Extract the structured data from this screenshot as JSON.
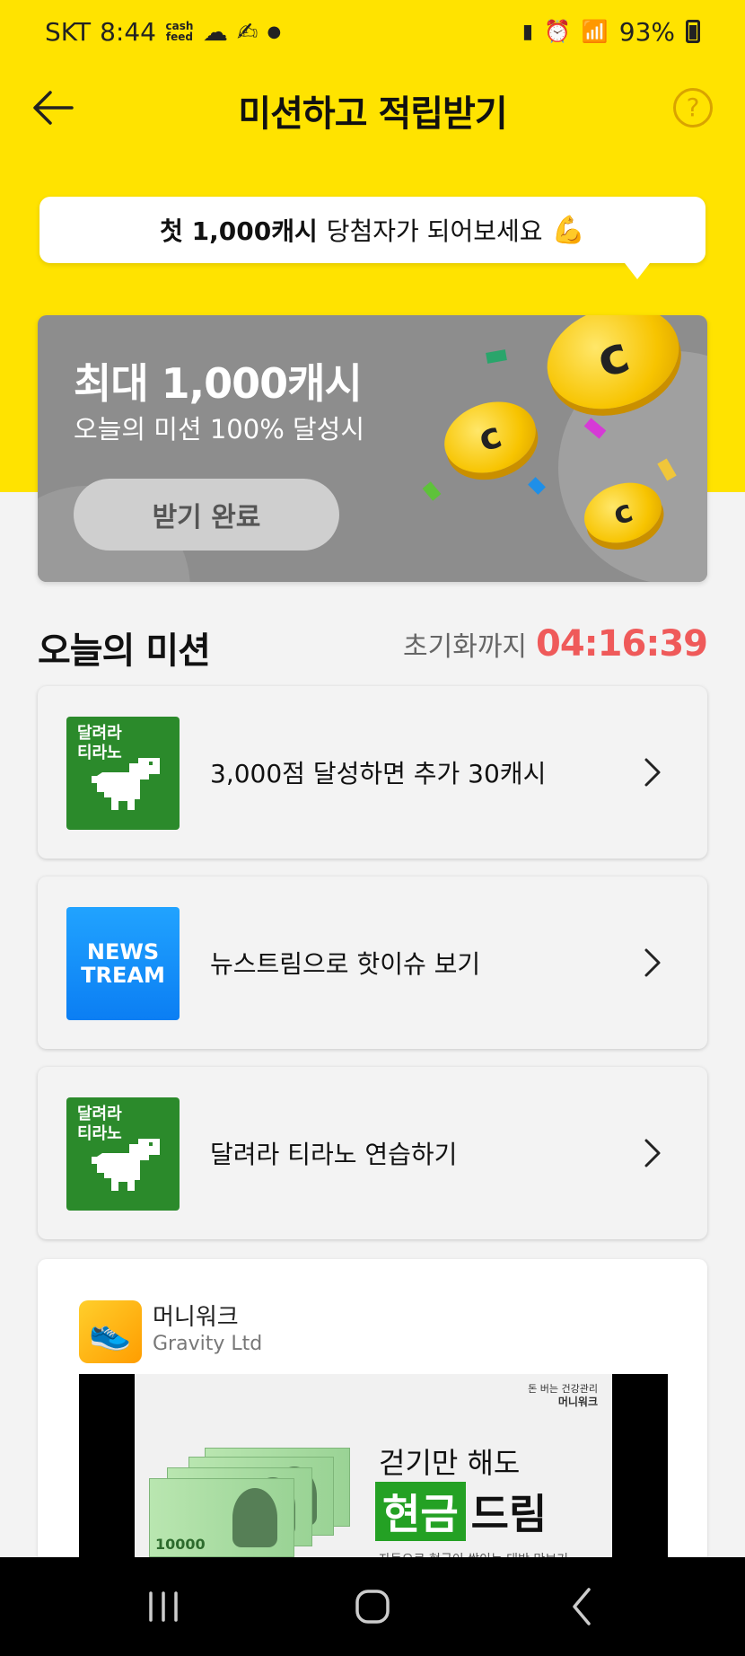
{
  "status_bar": {
    "carrier": "SKT",
    "time": "8:44",
    "cash_badge": "cash feed",
    "battery": "93%"
  },
  "header": {
    "title": "미션하고 적립받기",
    "help": "?"
  },
  "tooltip": {
    "bold": "첫 1,000캐시",
    "text": "당첨자가 되어보세요",
    "emoji": "💪"
  },
  "banner": {
    "title": "최대 1,000캐시",
    "subtitle": "오늘의 미션 100% 달성시",
    "button": "받기 완료"
  },
  "missions_section": {
    "title": "오늘의 미션",
    "reset_label": "초기화까지",
    "reset_time": "04:16:39"
  },
  "missions": [
    {
      "icon_text": "달려라\n티라노",
      "label": "3,000점 달성하면 추가 30캐시"
    },
    {
      "icon_text_1": "NEWS",
      "icon_text_2": "TREAM",
      "label": "뉴스트림으로 핫이슈 보기"
    },
    {
      "icon_text": "달려라\n티라노",
      "label": "달려라 티라노 연습하기"
    }
  ],
  "ad": {
    "app_name": "머니워크",
    "company": "Gravity Ltd",
    "brand_tag": "돈 버는 건강관리",
    "brand_name": "머니워크",
    "line1": "걷기만 해도",
    "highlight": "현금",
    "line2_rest": "드림",
    "line3": "자동으로 현금이 쌓이는 대박 만보기",
    "bill_value": "10000"
  },
  "colors": {
    "header_bg": "#ffe300",
    "timer_red": "#ef5a5a",
    "dino_green": "#2b8a2b",
    "news_blue": "#0b7ef3"
  }
}
